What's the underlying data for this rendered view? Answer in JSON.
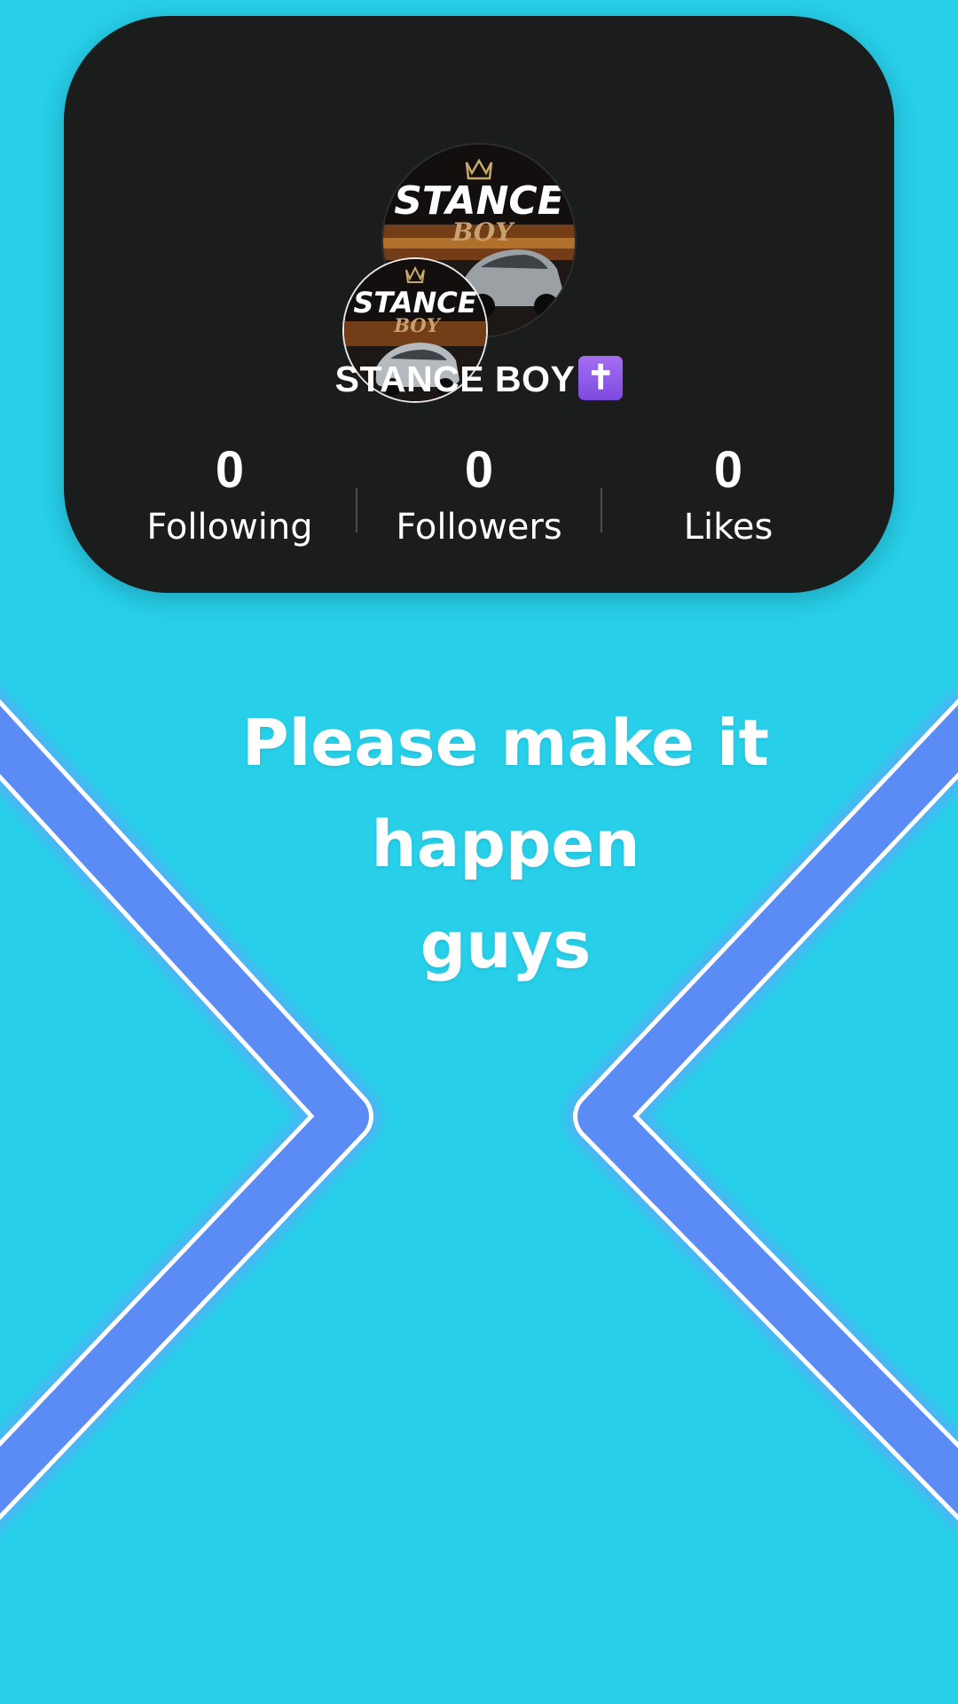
{
  "profile": {
    "username": "STANCE BOY",
    "badge_glyph": "✝",
    "avatar_logo_line1": "STANCE",
    "avatar_logo_line2": "BOY"
  },
  "stats": [
    {
      "value": "0",
      "label": "Following"
    },
    {
      "value": "0",
      "label": "Followers"
    },
    {
      "value": "0",
      "label": "Likes"
    }
  ],
  "message": {
    "line1": "Please make it happen",
    "line2": "guys"
  },
  "colors": {
    "background": "#27cfe9",
    "card": "#1b1d1d",
    "chevron": "#5b8cf5",
    "badge": "#8c5ae8"
  },
  "icons": {
    "left": "chevron-right-icon",
    "right": "chevron-left-icon",
    "badge": "latin-cross-icon"
  }
}
